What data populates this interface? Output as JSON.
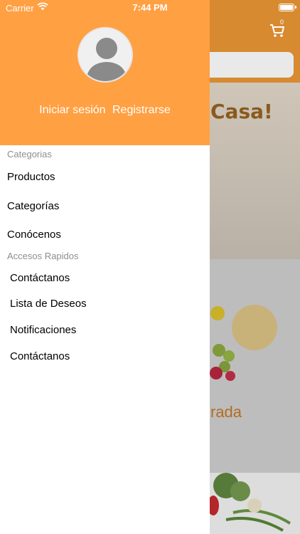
{
  "status_bar": {
    "carrier": "Carrier",
    "time": "7:44 PM"
  },
  "background": {
    "cart_count": "0",
    "banner_text": "Casa!",
    "section_text": "rada"
  },
  "drawer": {
    "login_label": "Iniciar sesión",
    "register_label": "Registrarse",
    "sections": {
      "categorias_title": "Categorias",
      "accesos_title": "Accesos Rapidos"
    },
    "categorias_items": [
      "Productos",
      "Categorías",
      "Conócenos"
    ],
    "accesos_items": [
      "Contáctanos",
      "Lista de Deseos",
      "Notificaciones",
      "Contáctanos"
    ]
  },
  "colors": {
    "drawer_header": "#ffa043",
    "background_header": "#d78a30",
    "section_title": "#8e8e8e"
  },
  "icons": [
    "wifi-icon",
    "battery-icon",
    "cart-icon",
    "avatar-icon"
  ]
}
